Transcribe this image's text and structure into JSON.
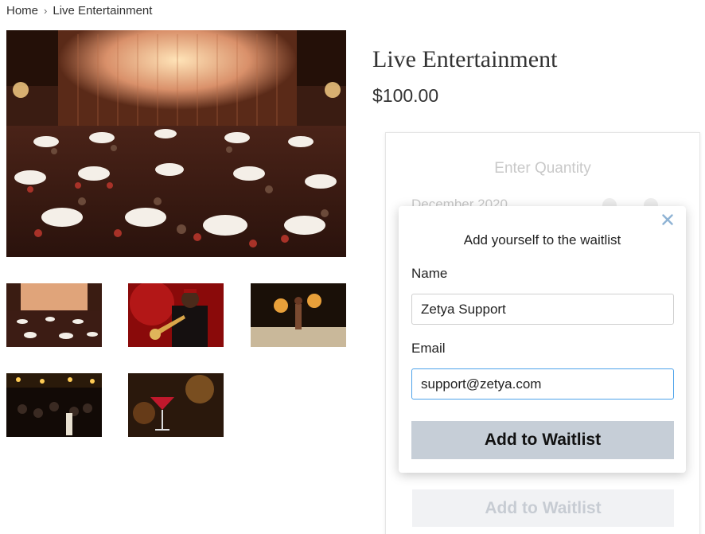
{
  "breadcrumb": {
    "home": "Home",
    "separator": "›",
    "current": "Live Entertainment"
  },
  "product": {
    "title": "Live Entertainment",
    "price": "$100.00"
  },
  "gallery": {
    "main_image": "dinner-theater-hall-photo",
    "thumbnails": [
      "dinner-theater-hall-photo",
      "jazz-trumpet-player-photo",
      "fire-dancer-photo",
      "nightclub-crowd-photo",
      "cocktail-bar-photo"
    ]
  },
  "booking": {
    "quantity_label": "Enter Quantity",
    "month_label": "December 2020",
    "bottom_button_label": "Add to Waitlist"
  },
  "waitlist_modal": {
    "title": "Add yourself to the waitlist",
    "close_icon": "close-x-icon",
    "name_label": "Name",
    "name_value": "Zetya Support",
    "email_label": "Email",
    "email_value": "support@zetya.com",
    "submit_label": "Add to Waitlist"
  },
  "colors": {
    "submit_bg": "#c6ced7",
    "focus_border": "#4da3ea",
    "close_icon": "#8fb3d4"
  }
}
